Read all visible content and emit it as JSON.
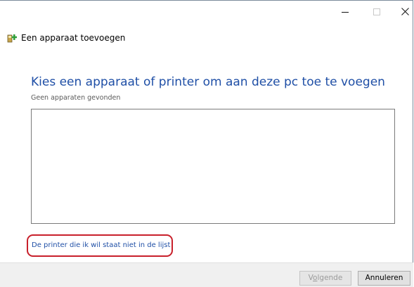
{
  "window": {
    "title": "Een apparaat toevoegen",
    "controls": {
      "minimize": "minimize-icon",
      "maximize": "maximize-icon",
      "close": "close-icon"
    }
  },
  "main": {
    "heading": "Kies een apparaat of printer om aan deze pc toe te voegen",
    "status": "Geen apparaten gevonden",
    "devices": [],
    "link": "De printer die ik wil staat niet in de lijst"
  },
  "footer": {
    "next_prefix": "V",
    "next_underlined": "o",
    "next_suffix": "lgende",
    "cancel": "Annuleren"
  },
  "colors": {
    "heading": "#1f4fa6",
    "link": "#1f4fa6",
    "highlight": "#c8202b",
    "footer_bg": "#f0f0f0"
  }
}
